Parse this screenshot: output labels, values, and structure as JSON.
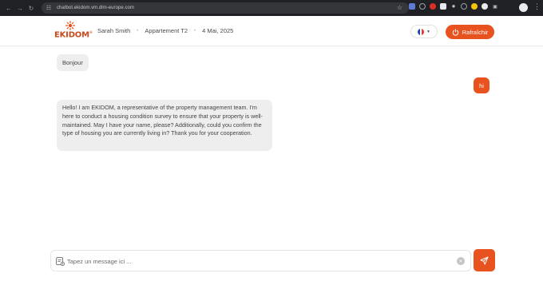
{
  "browser": {
    "url": "chatbot.ekidom.vm.dlm-europe.com"
  },
  "header": {
    "logo_text": "EKIDOM",
    "user_name": "Sarah Smith",
    "property": "Appartement T2",
    "date": "4 Mai, 2025",
    "refresh_label": "Rafraîchir",
    "language": "fr"
  },
  "messages": [
    {
      "role": "bot",
      "text": "Bonjour"
    },
    {
      "role": "user",
      "text": "hi"
    },
    {
      "role": "bot",
      "text": "Hello! I am EKIDOM, a representative of the property management team. I'm here to conduct a housing condition survey to ensure that your property is well-maintained. May I have your name, please? Additionally, could you confirm the type of housing you are currently living in? Thank you for your cooperation."
    }
  ],
  "composer": {
    "placeholder": "Tapez un message ici ..."
  },
  "colors": {
    "accent": "#e8521f",
    "bubble_bg": "#eeeeee"
  }
}
